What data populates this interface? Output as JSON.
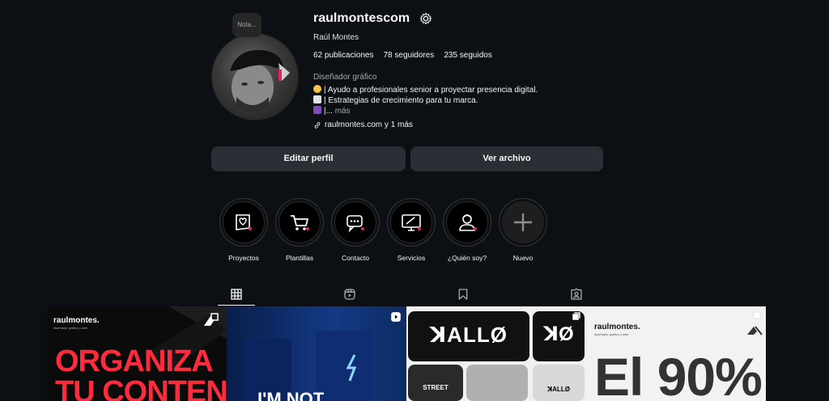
{
  "profile": {
    "note_label": "Nota...",
    "username": "raulmontescom",
    "full_name": "Raúl Montes",
    "stats": {
      "posts": "62 publicaciones",
      "followers": "78 seguidores",
      "following": "235 seguidos"
    },
    "category": "Diseñador gráfico",
    "bio": [
      {
        "icon": "lightbulb-icon",
        "text": "| Ayudo a profesionales senior a proyectar presencia digital."
      },
      {
        "icon": "chart-icon",
        "text": "| Estrategias de crecimiento para tu marca."
      },
      {
        "icon": "book-icon",
        "text": "|..."
      }
    ],
    "more_label": "más",
    "link_text": "raulmontes.com y 1 más"
  },
  "actions": {
    "edit_profile": "Editar perfil",
    "view_archive": "Ver archivo"
  },
  "highlights": [
    {
      "label": "Proyectos",
      "icon": "portfolio-icon"
    },
    {
      "label": "Plantillas",
      "icon": "cart-icon"
    },
    {
      "label": "Contacto",
      "icon": "chat-icon"
    },
    {
      "label": "Servicios",
      "icon": "monitor-design-icon"
    },
    {
      "label": "¿Quién soy?",
      "icon": "person-icon"
    },
    {
      "label": "Nuevo",
      "icon": "plus-icon"
    }
  ],
  "tabs": [
    "grid-icon",
    "reels-icon",
    "saved-icon",
    "tagged-icon"
  ],
  "posts": [
    {
      "brand": "raulmontes.",
      "tagline": "diseñador gráfico y web",
      "headline_1": "ORGANIZA",
      "headline_2": "TU CONTENIDO",
      "bg": "#0b0b0b",
      "accent": "#ff2b3d"
    },
    {
      "headline": "I'M NOT",
      "bg": "#0d2b63"
    },
    {
      "tile_text_1": "ꓘALLØ",
      "tile_text_2": "ꓘØ",
      "tile_text_3": "STREET",
      "tile_text_4": "ꓘALLØ"
    },
    {
      "brand": "raulmontes.",
      "tagline": "diseñador gráfico y web",
      "headline": "El 90%",
      "bg": "#f2f2f2"
    }
  ],
  "colors": {
    "background": "#0c1014",
    "button": "#2a2f35",
    "muted": "#a8a8a8",
    "accent_red": "#e0245e"
  }
}
